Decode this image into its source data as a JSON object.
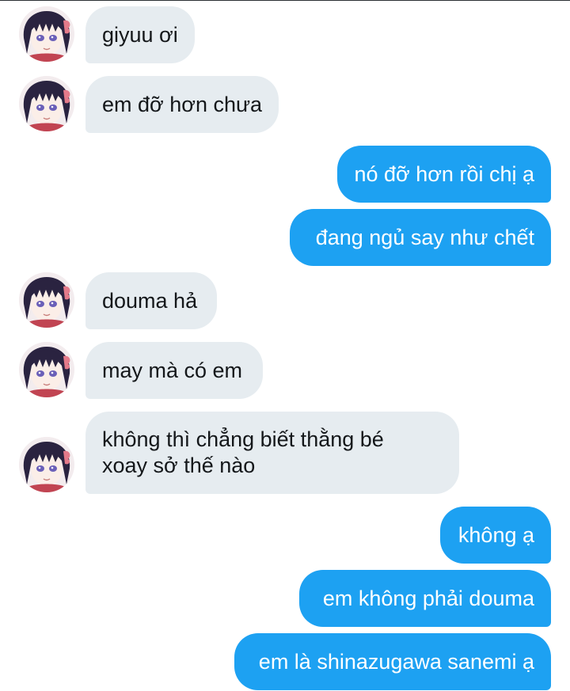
{
  "conversation": {
    "messages": [
      {
        "side": "in",
        "text": "giyuu ơi"
      },
      {
        "side": "in",
        "text": "em đỡ hơn chưa"
      },
      {
        "side": "out",
        "text": "nó đỡ hơn rồi chị ạ"
      },
      {
        "side": "out",
        "text": "đang ngủ say như chết"
      },
      {
        "side": "in",
        "text": "douma hả"
      },
      {
        "side": "in",
        "text": "may mà có em"
      },
      {
        "side": "in",
        "line1": "không thì chẳng biết thằng bé",
        "line2": "xoay sở thế nào"
      },
      {
        "side": "out",
        "text": "không ạ"
      },
      {
        "side": "out",
        "text": "em không phải douma"
      },
      {
        "side": "out",
        "text": "em là shinazugawa sanemi ạ"
      }
    ]
  },
  "colors": {
    "incoming_bubble": "#e6ecf0",
    "outgoing_bubble": "#1da1f2",
    "incoming_text": "#14171a",
    "outgoing_text": "#ffffff"
  },
  "icons": {
    "avatar": "contact-avatar"
  }
}
